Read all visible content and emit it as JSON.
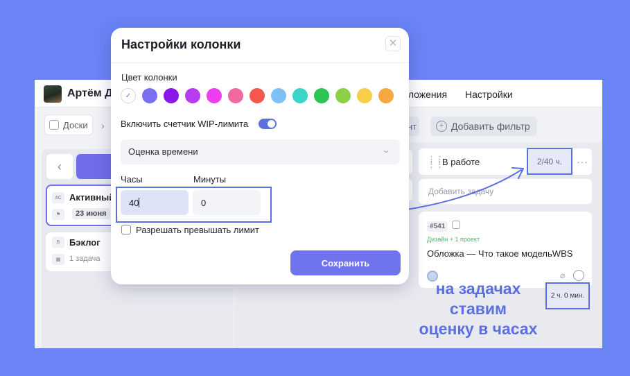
{
  "header": {
    "user_name": "Артём Д",
    "nav_apps": "иложения",
    "nav_settings": "Настройки"
  },
  "toolbar": {
    "docs_label": "Доски",
    "partial_chip": "нт",
    "add_filter": "Добавить фильтр"
  },
  "sidebar": {
    "active_card": {
      "tag": "АС",
      "title": "Активный",
      "date": "23 июня"
    },
    "backlog_card": {
      "tag": "Б",
      "title": "Бэклог",
      "count": "1 задача"
    }
  },
  "board": {
    "column_title": "В работе",
    "wip": "2/40 ч.",
    "add_task": "Добавить задачу",
    "task": {
      "number": "#541",
      "project": "Дизайн + 1 проект",
      "title": "Обложка — Что такое модельWBS",
      "estimate": "2 ч. 0 мин."
    }
  },
  "modal": {
    "title": "Настройки колонки",
    "color_label": "Цвет колонки",
    "colors": [
      "#ffffff",
      "#7b6ef0",
      "#8a18e8",
      "#b93df0",
      "#ec3df0",
      "#f06aa0",
      "#f5564e",
      "#7cc0f5",
      "#3ad4c8",
      "#2ec454",
      "#8dd048",
      "#f5cf4a",
      "#f5a83e"
    ],
    "wip_toggle_label": "Включить счетчик WIP-лимита",
    "wip_enabled": true,
    "estimate_type": "Оценка времени",
    "hours_label": "Часы",
    "minutes_label": "Минуты",
    "hours_value": "40",
    "minutes_value": "0",
    "allow_exceed_label": "Разрешать превышать лимит",
    "save_label": "Сохранить"
  },
  "annotation": {
    "line1": "на задачах",
    "line2": "ставим",
    "line3": "оценку в часах"
  }
}
